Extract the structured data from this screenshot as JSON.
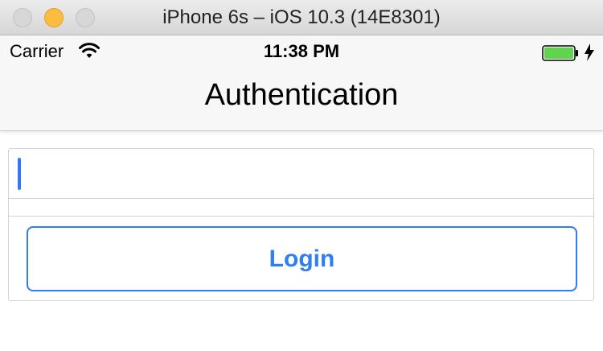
{
  "window": {
    "title": "iPhone 6s – iOS 10.3 (14E8301)"
  },
  "status_bar": {
    "carrier": "Carrier",
    "time": "11:38 PM",
    "wifi_icon": "wifi-icon",
    "battery_icon": "battery-icon",
    "charging_icon": "bolt-icon",
    "battery_level": 1.0
  },
  "nav": {
    "title": "Authentication"
  },
  "form": {
    "username_value": "",
    "password_value": "",
    "login_label": "Login"
  },
  "colors": {
    "accent": "#2f7ff0",
    "battery": "#5fd44c",
    "traffic_yellow": "#fdbb40"
  }
}
